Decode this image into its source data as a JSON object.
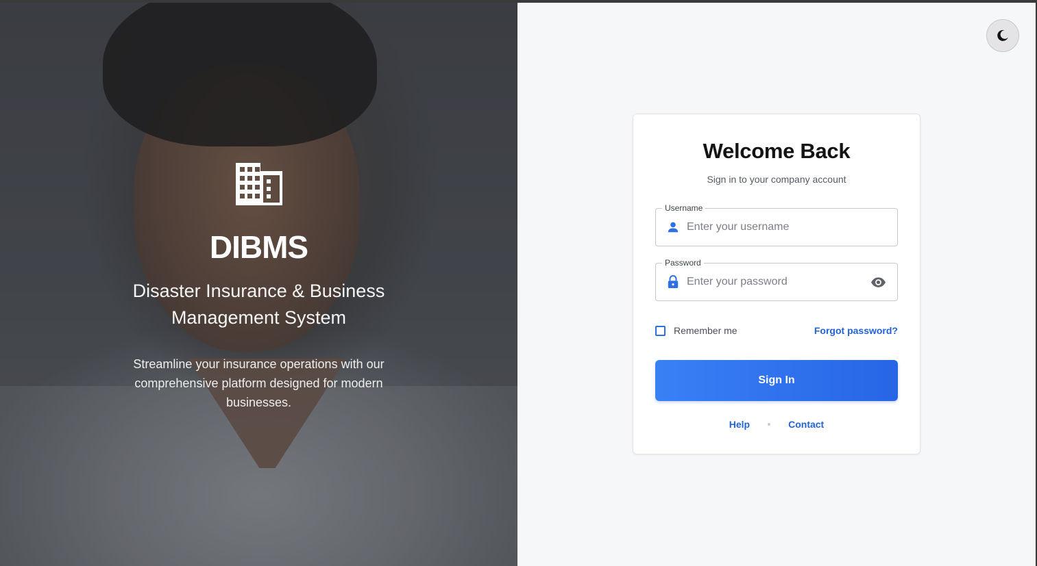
{
  "hero": {
    "icon": "building-icon",
    "brand": "DIBMS",
    "tagline": "Disaster Insurance & Business Management System",
    "description": "Streamline your insurance operations with our comprehensive platform designed for modern businesses."
  },
  "theme_toggle": {
    "icon": "moon-icon"
  },
  "login": {
    "title": "Welcome Back",
    "subtitle": "Sign in to your company account",
    "username": {
      "label": "Username",
      "placeholder": "Enter your username",
      "value": "",
      "icon": "user-icon"
    },
    "password": {
      "label": "Password",
      "placeholder": "Enter your password",
      "value": "",
      "icon": "lock-icon",
      "toggle_icon": "eye-icon"
    },
    "remember_label": "Remember me",
    "remember_checked": false,
    "forgot_label": "Forgot password?",
    "submit_label": "Sign In",
    "footer": {
      "help": "Help",
      "contact": "Contact"
    }
  },
  "colors": {
    "accent": "#2765e6",
    "accent_light": "#3a80f5",
    "link": "#2363d8",
    "panel_bg": "#f6f7f9"
  }
}
